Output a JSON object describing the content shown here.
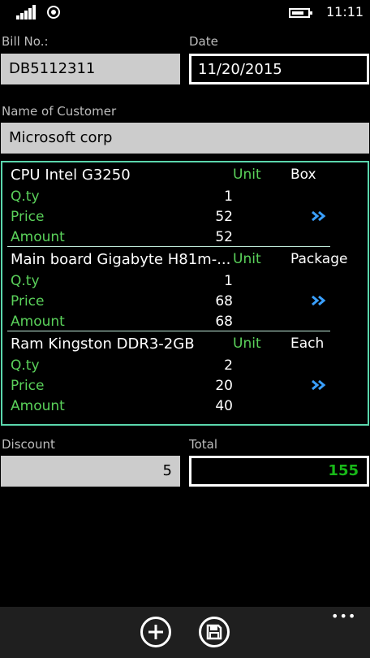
{
  "status": {
    "time": "11:11"
  },
  "form": {
    "bill_label": "Bill No.:",
    "bill_value": "DB5112311",
    "date_label": "Date",
    "date_value": "11/20/2015",
    "customer_label": "Name of Customer",
    "customer_value": "Microsoft corp",
    "discount_label": "Discount",
    "discount_value": "5",
    "total_label": "Total",
    "total_value": "155"
  },
  "item_labels": {
    "unit": "Unit",
    "qty": "Q.ty",
    "price": "Price",
    "amount": "Amount"
  },
  "items": [
    {
      "name": "CPU Intel G3250",
      "unit": "Box",
      "qty": "1",
      "price": "52",
      "amount": "52"
    },
    {
      "name": "Main board Gigabyte H81m-...",
      "unit": "Package",
      "qty": "1",
      "price": "68",
      "amount": "68"
    },
    {
      "name": "Ram Kingston DDR3-2GB",
      "unit": "Each",
      "qty": "2",
      "price": "20",
      "amount": "40"
    }
  ],
  "appbar": {
    "more": "•••"
  },
  "icons": {
    "add": "add-icon",
    "save": "save-icon",
    "more": "more-icon"
  }
}
